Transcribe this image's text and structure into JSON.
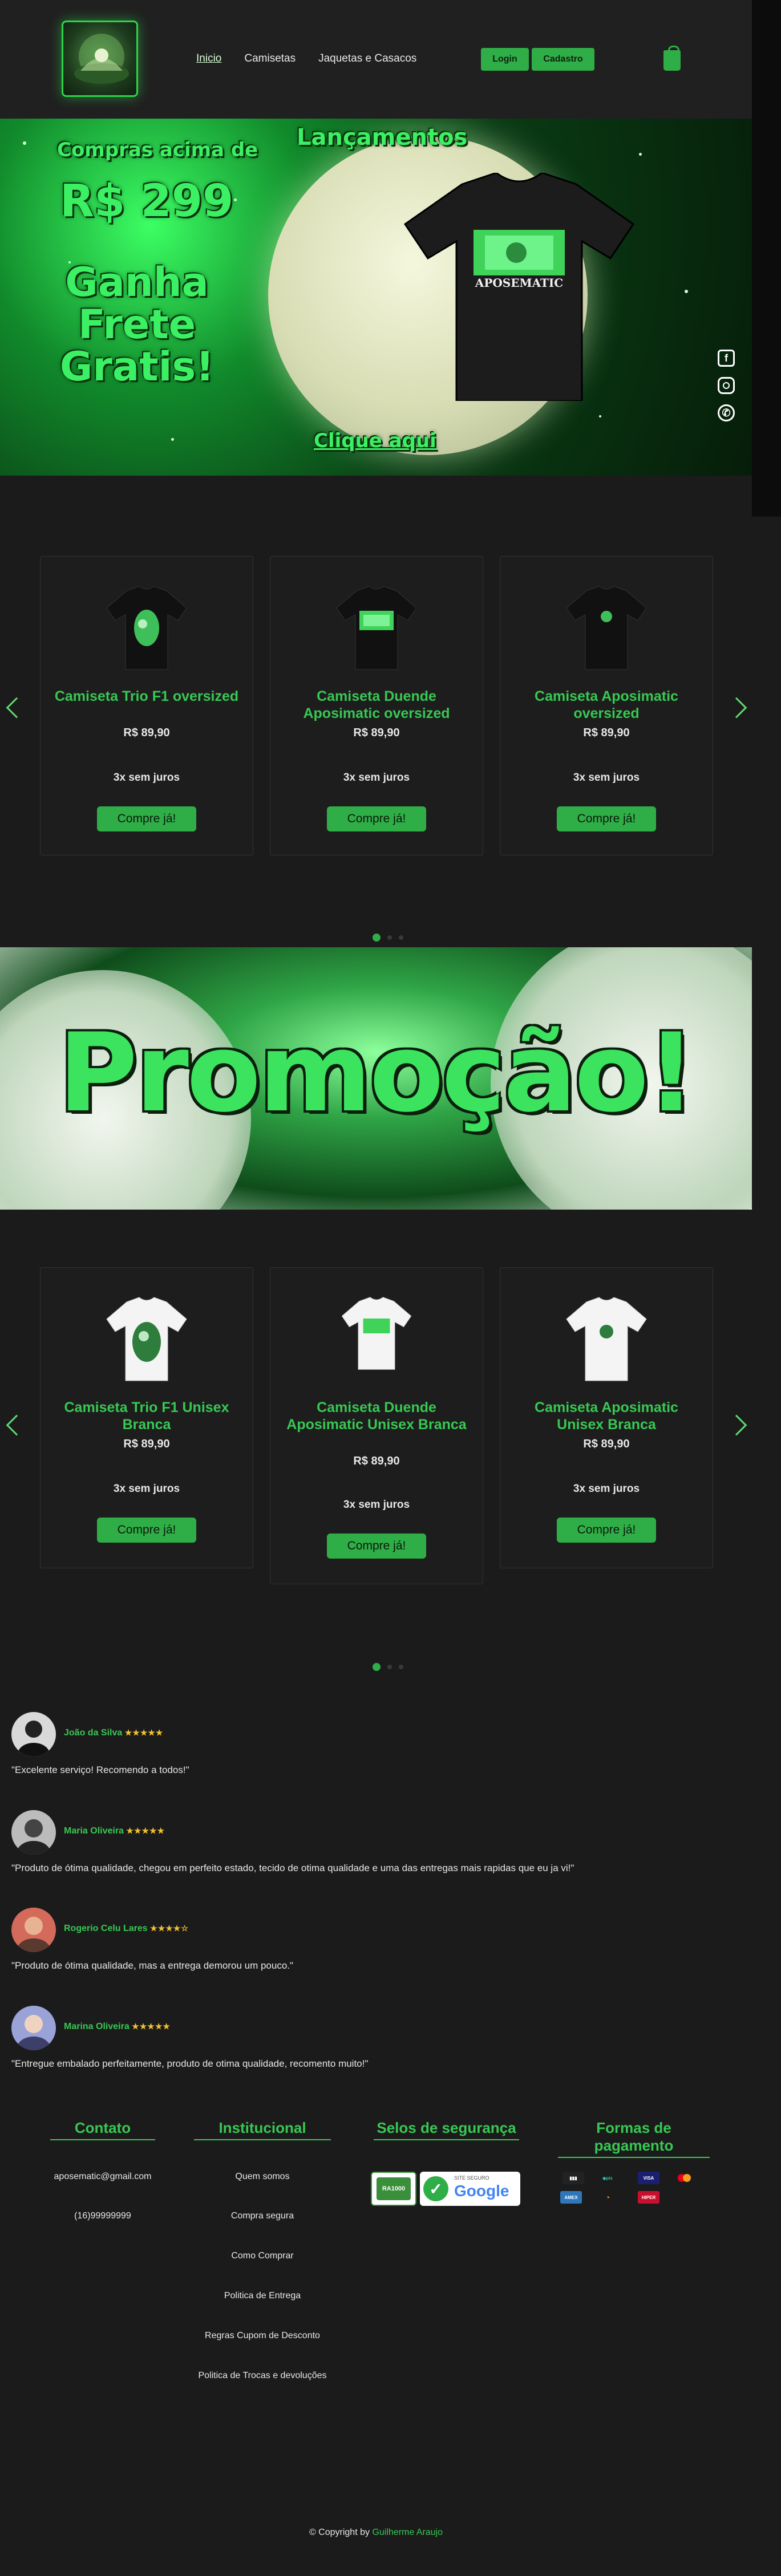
{
  "nav": {
    "items": [
      {
        "label": "Inicio"
      },
      {
        "label": "Camisetas"
      },
      {
        "label": "Jaquetas e Casacos"
      }
    ],
    "login_label": "Login",
    "signup_label": "Cadastro"
  },
  "hero": {
    "line1": "Compras acima de",
    "amount": "R$ 299",
    "line2": "Ganha",
    "line3": "Frete",
    "line4": "Gratis!",
    "launch": "Lançamentos",
    "cta": "Clique aqui",
    "shirt_print": "APOSEMATIC",
    "socials": [
      "facebook-icon",
      "instagram-icon",
      "whatsapp-icon"
    ]
  },
  "products_black": [
    {
      "name": "Camiseta Trio F1 oversized",
      "price": "R$ 89,90",
      "installments": "3x sem juros",
      "buy": "Compre já!"
    },
    {
      "name": "Camiseta Duende Aposimatic oversized",
      "price": "R$ 89,90",
      "installments": "3x sem juros",
      "buy": "Compre já!"
    },
    {
      "name": "Camiseta Aposimatic oversized",
      "price": "R$ 89,90",
      "installments": "3x sem juros",
      "buy": "Compre já!"
    }
  ],
  "promo": {
    "title": "Promoção!"
  },
  "products_white": [
    {
      "name": "Camiseta Trio F1 Unisex Branca",
      "price": "R$ 89,90",
      "installments": "3x sem juros",
      "buy": "Compre já!"
    },
    {
      "name": "Camiseta Duende Aposimatic Unisex Branca",
      "price": "R$ 89,90",
      "installments": "3x sem juros",
      "buy": "Compre já!"
    },
    {
      "name": "Camiseta Aposimatic Unisex Branca",
      "price": "R$ 89,90",
      "installments": "3x sem juros",
      "buy": "Compre já!"
    }
  ],
  "reviews": [
    {
      "name": "João da Silva",
      "stars": "★★★★★",
      "text": "\"Excelente serviço! Recomendo a todos!\""
    },
    {
      "name": "Maria Oliveira",
      "stars": "★★★★★",
      "text": "\"Produto de ótima qualidade, chegou em perfeito estado, tecido de otima qualidade e uma das entregas mais rapidas que eu ja vi!\""
    },
    {
      "name": "Rogerio Celu Lares",
      "stars": "★★★★☆",
      "text": "\"Produto de ótima qualidade, mas a entrega demorou um pouco.\""
    },
    {
      "name": "Marina Oliveira",
      "stars": "★★★★★",
      "text": "\"Entregue embalado perfeitamente, produto de otima qualidade, recomento muito!\""
    }
  ],
  "footer": {
    "contact_title": "Contato",
    "email": "aposematic@gmail.com",
    "phone": "(16)99999999",
    "inst_title": "Institucional",
    "inst_links": [
      "Quem somos",
      "Compra segura",
      "Como Comprar",
      "Politica de Entrega",
      "Regras Cupom de Desconto",
      "Politica de Trocas e devoluções"
    ],
    "seals_title": "Selos de segurança",
    "seal_ra": "RA1000",
    "seal_google": "Google",
    "seal_google_top": "SITE SEGURO",
    "payment_title": "Formas de pagamento",
    "copyright_prefix": "© Copyright by ",
    "copyright_author": "Guilherme Araujo"
  },
  "colors": {
    "accent": "#2fae47",
    "accent_text": "#37c853",
    "bg": "#1b1b1b",
    "star": "#f1c232"
  }
}
